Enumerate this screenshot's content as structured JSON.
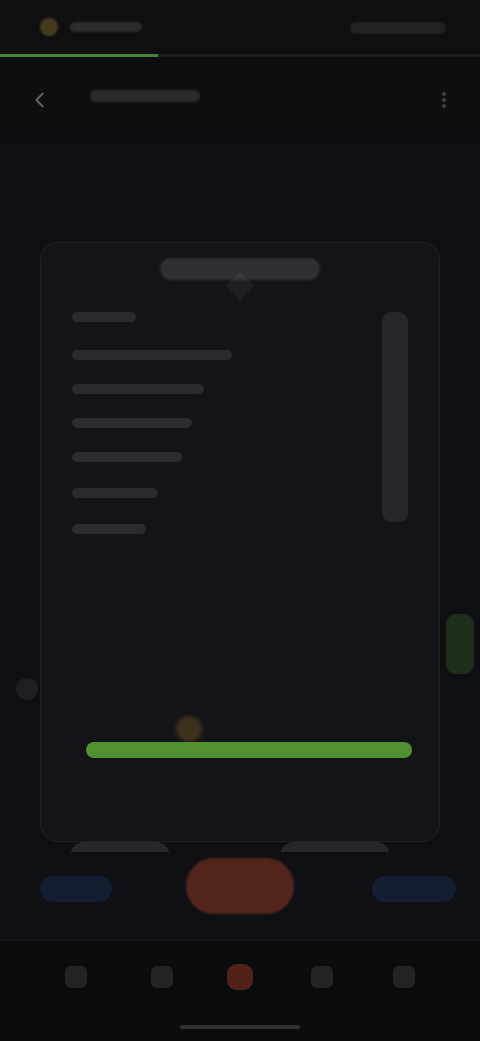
{
  "status": {
    "progress_fraction": 0.33
  },
  "accent_colors": {
    "green": "#5aa534",
    "red": "#d24b2a",
    "blue": "#1d3b66"
  },
  "header": {
    "back_icon": "arrow-left-icon",
    "more_icon": "more-vertical-icon"
  },
  "track": {
    "level_fraction": 1.0
  },
  "nav": {
    "icons": [
      "home-icon",
      "list-icon",
      "fire-icon",
      "chart-icon",
      "user-icon"
    ],
    "active_index": 2
  }
}
